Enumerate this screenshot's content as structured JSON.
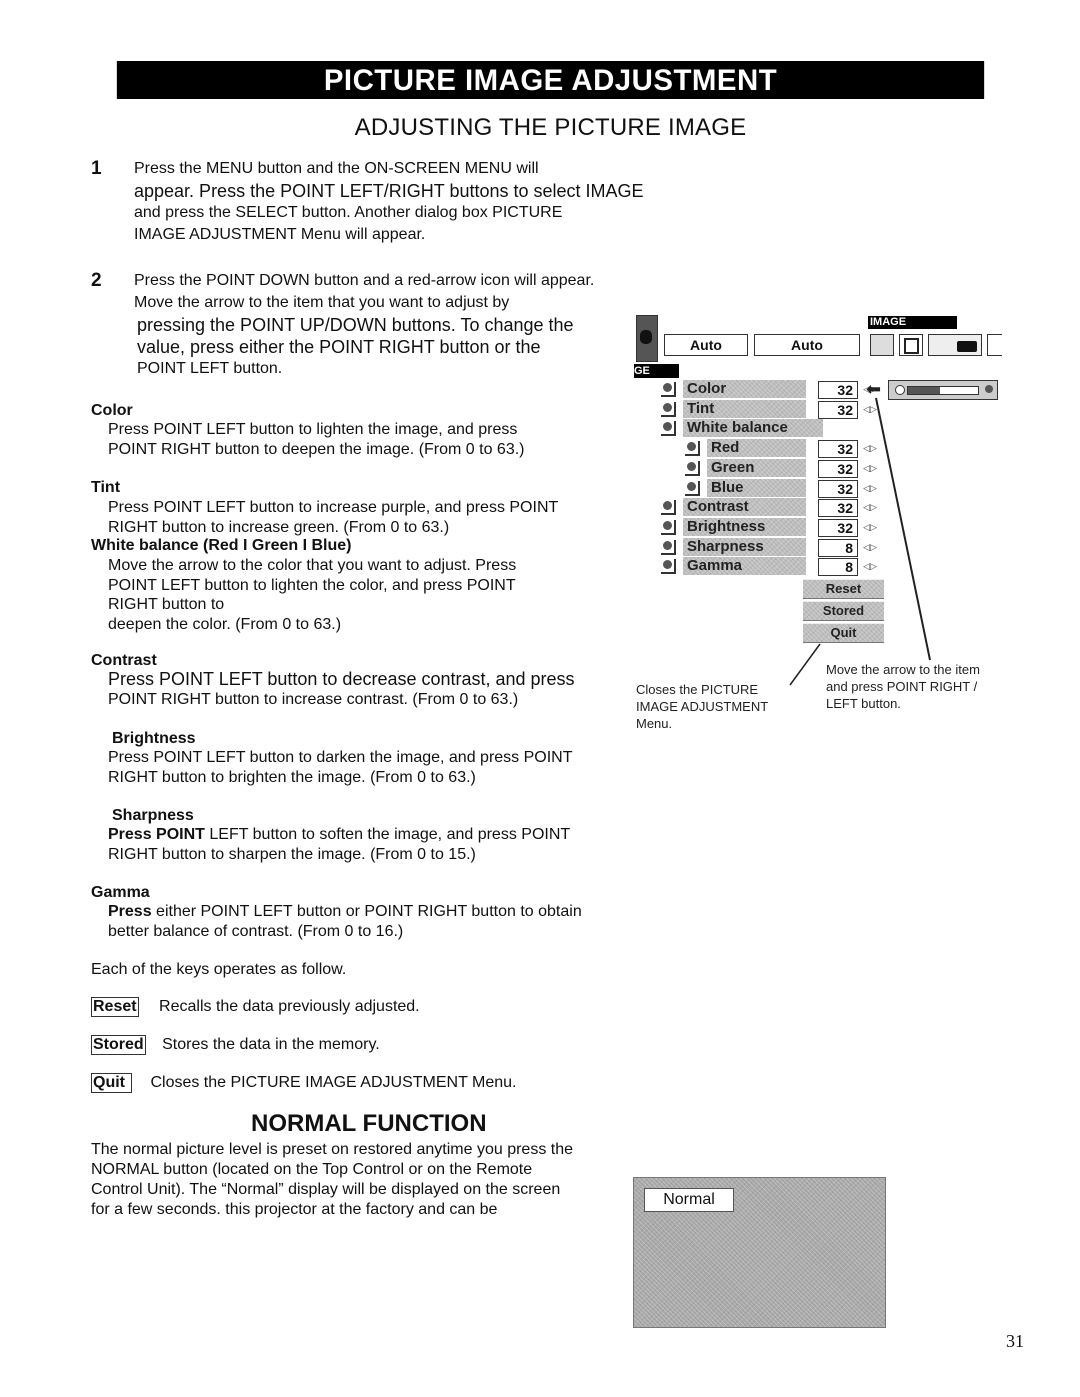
{
  "banner": "PICTURE IMAGE ADJUSTMENT",
  "subtitle": "ADJUSTING THE PICTURE IMAGE",
  "steps": [
    {
      "num": "1",
      "lines": [
        "Press the MENU button and the ON-SCREEN MENU will",
        "appear. Press the POINT LEFT/RIGHT buttons to select IMAGE",
        "and press the SELECT button. Another dialog box PICTURE",
        "IMAGE ADJUSTMENT Menu will appear."
      ]
    },
    {
      "num": "2",
      "lines": [
        "Press the POINT DOWN button and a red-arrow icon will appear.",
        "Move the arrow to the item that you want to adjust by",
        "pressing the POINT UP/DOWN buttons. To change the",
        "value, press either the POINT RIGHT button or the",
        "POINT LEFT button."
      ]
    }
  ],
  "items": {
    "color": {
      "heading": "Color",
      "lines": [
        "Press POINT LEFT button to lighten the image, and press",
        "POINT RIGHT button to deepen the image. (From 0 to 63.)"
      ]
    },
    "tint": {
      "heading": "Tint",
      "lines": [
        "Press POINT LEFT button to increase purple, and press POINT",
        "RIGHT button to increase green. (From 0 to 63.)"
      ]
    },
    "white_balance": {
      "heading": "White balance (Red I Green I Blue)",
      "lines": [
        "Move the arrow to the color that you want to adjust. Press",
        "POINT LEFT button to lighten the color, and press POINT",
        "RIGHT button to",
        "deepen the color. (From 0 to 63.)"
      ]
    },
    "contrast": {
      "heading": "Contrast",
      "lines": [
        "Press POINT LEFT button to decrease contrast, and press",
        "POINT RIGHT button to increase contrast. (From 0 to 63.)"
      ]
    },
    "brightness": {
      "heading": "Brightness",
      "lines": [
        "Press POINT LEFT button to darken the image, and press POINT",
        "RIGHT button to brighten the image. (From 0 to 63.)"
      ]
    },
    "sharpness": {
      "heading": "Sharpness",
      "bold_lead": "Press POINT",
      "lines": [
        " LEFT button to soften the image, and press POINT",
        "RIGHT button to sharpen the image. (From 0 to 15.)"
      ]
    },
    "gamma": {
      "heading": "Gamma",
      "bold_lead": "Press",
      "lines": [
        " either POINT LEFT button or POINT RIGHT button to obtain",
        "better balance of contrast. (From 0 to 16.)"
      ]
    }
  },
  "keys_intro": "Each of the keys operates as follow.",
  "keys": [
    {
      "label": "Reset",
      "desc": "Recalls the data previously adjusted."
    },
    {
      "label": "Stored",
      "desc": "Stores the data in the memory."
    },
    {
      "label": "Quit",
      "desc": "Closes the PICTURE IMAGE ADJUSTMENT Menu."
    }
  ],
  "menu_screenshot": {
    "tab_label": "IMAGE",
    "side_tab": "GE",
    "top_boxes": [
      "Auto",
      "Auto"
    ],
    "rows": [
      {
        "label": "Color",
        "value": "32"
      },
      {
        "label": "Tint",
        "value": "32"
      },
      {
        "label": "White balance",
        "value": ""
      },
      {
        "label": "Red",
        "value": "32"
      },
      {
        "label": "Green",
        "value": "32"
      },
      {
        "label": "Blue",
        "value": "32"
      },
      {
        "label": "Contrast",
        "value": "32"
      },
      {
        "label": "Brightness",
        "value": "32"
      },
      {
        "label": "Sharpness",
        "value": "8"
      },
      {
        "label": "Gamma",
        "value": "8"
      }
    ],
    "buttons": [
      "Reset",
      "Stored",
      "Quit"
    ],
    "callout_left": [
      "Closes the PICTURE",
      "IMAGE ADJUSTMENT",
      "Menu."
    ],
    "callout_right": [
      "Move the arrow to the item",
      "and press POINT RIGHT /",
      "LEFT button."
    ]
  },
  "normal": {
    "title": "NORMAL FUNCTION",
    "lines": [
      "The normal picture level is preset on restored anytime you press the",
      "NORMAL button (located on the Top Control or on the Remote",
      "Control Unit). The “Normal” display will be displayed on the screen",
      "for a few seconds.  this projector at the factory and can be"
    ],
    "screen_label": "Normal"
  },
  "page_number": "31"
}
